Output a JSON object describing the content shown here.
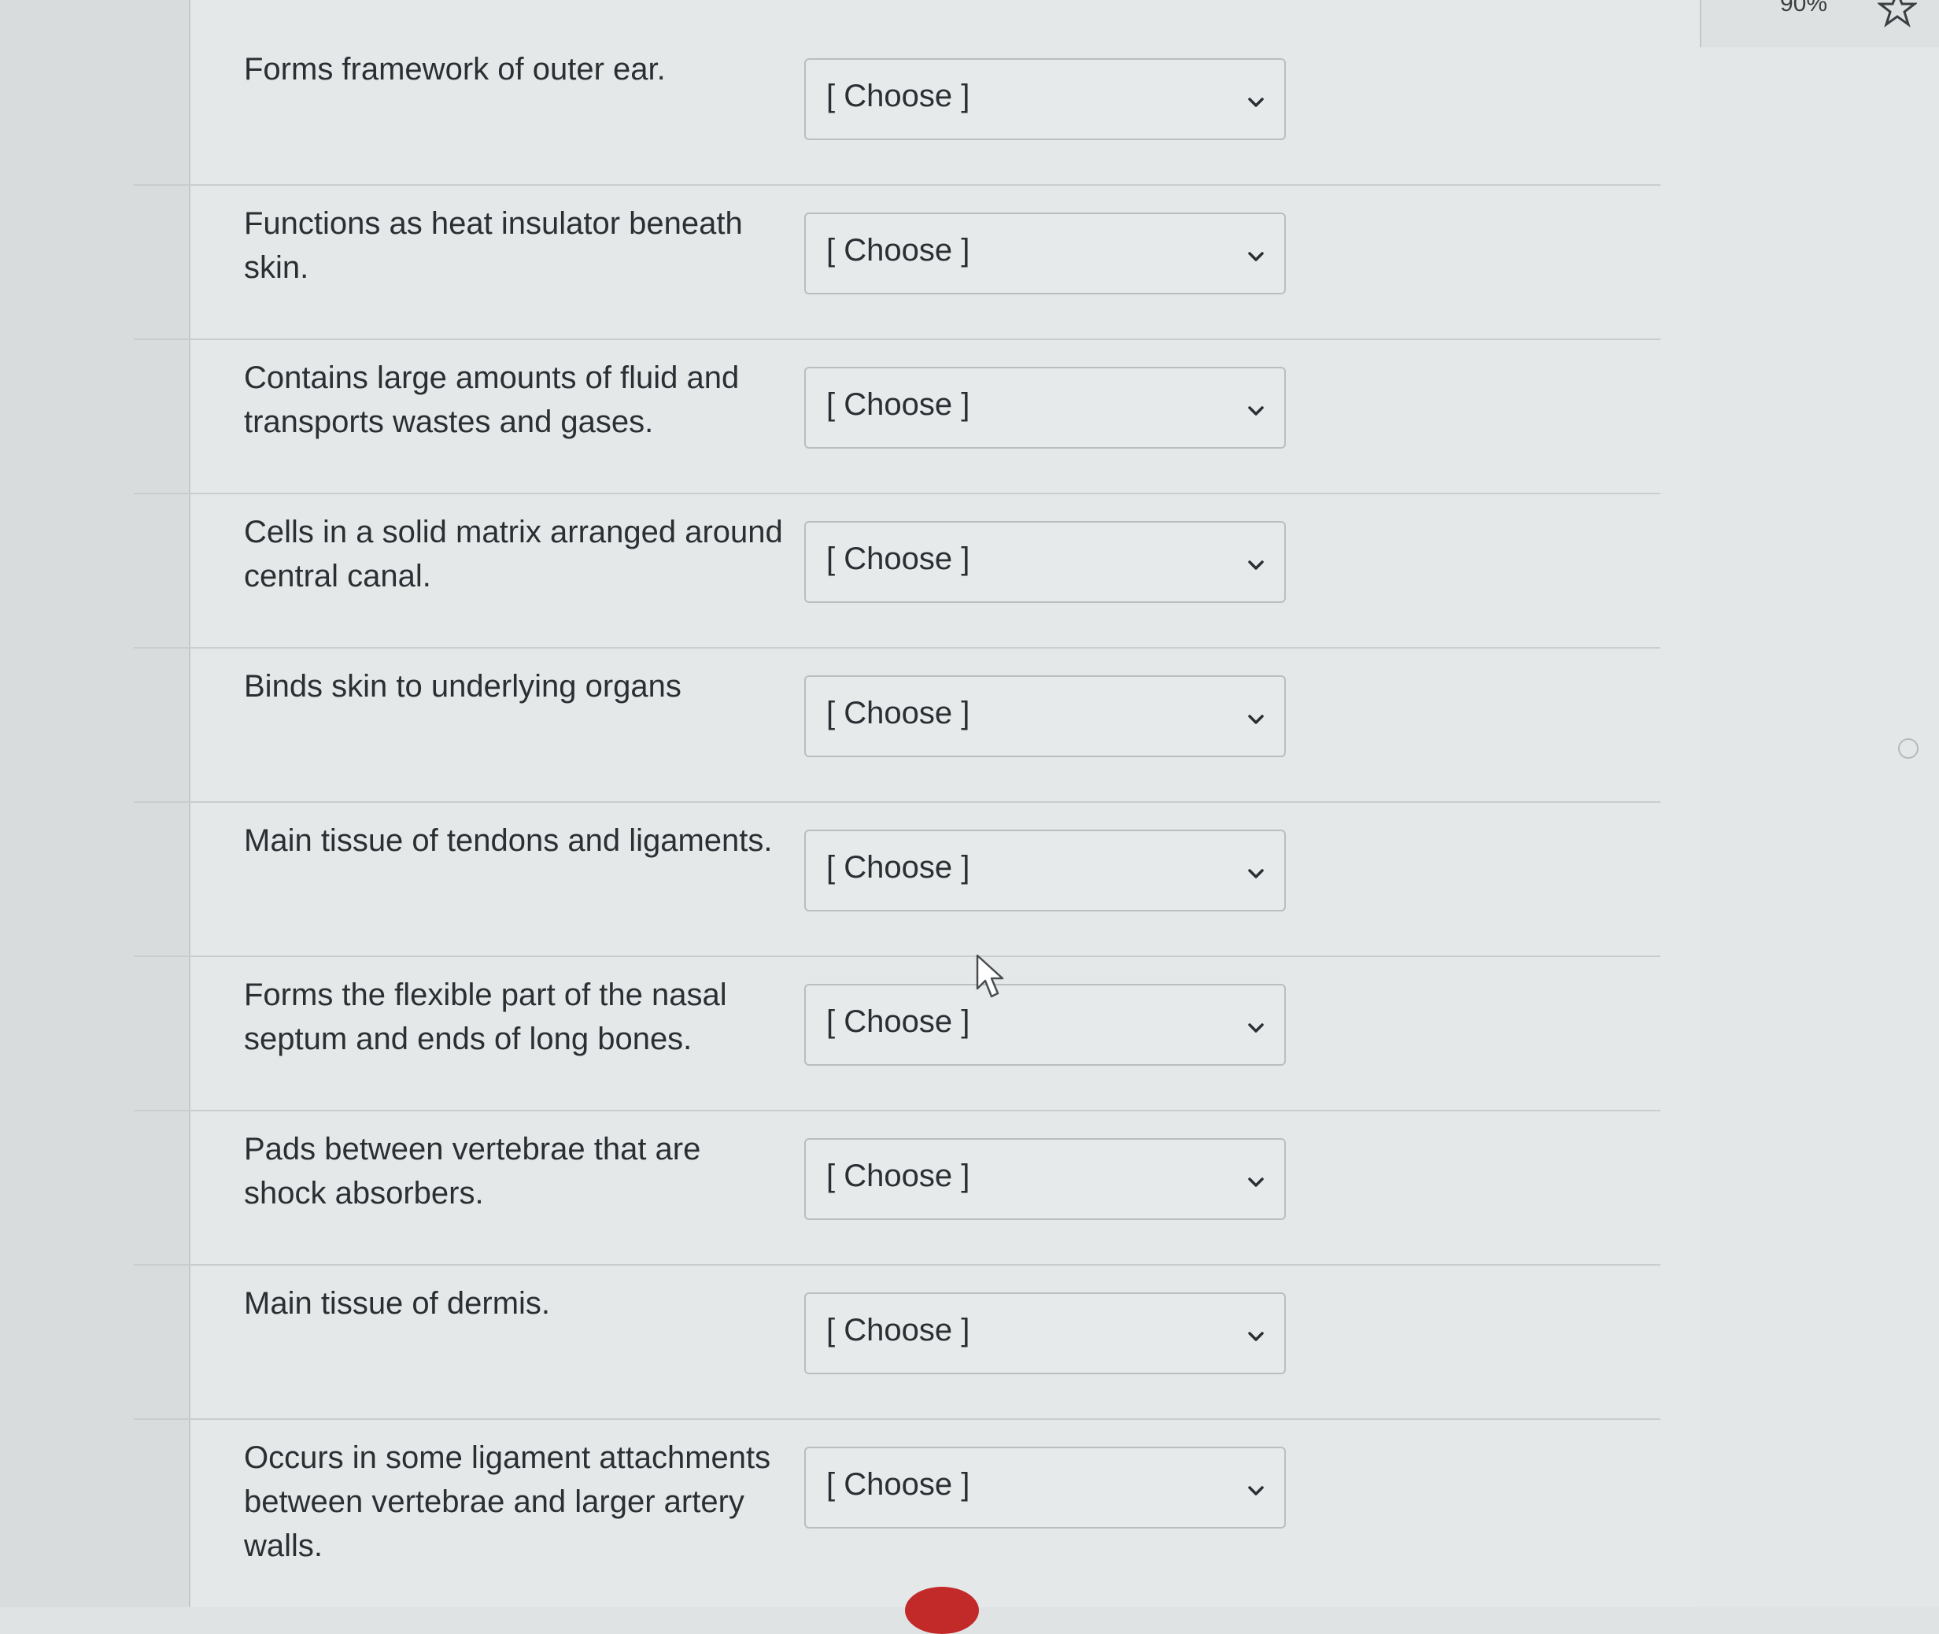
{
  "browser": {
    "zoom_level": "90%",
    "bookmark_icon": "star-icon"
  },
  "quiz": {
    "questions": [
      {
        "prompt": "Forms framework of outer ear.",
        "selected": "[ Choose ]"
      },
      {
        "prompt": "Functions as heat insulator beneath skin.",
        "selected": "[ Choose ]"
      },
      {
        "prompt": "Contains large amounts of fluid and transports wastes and gases.",
        "selected": "[ Choose ]"
      },
      {
        "prompt": "Cells in a solid matrix arranged around central canal.",
        "selected": "[ Choose ]"
      },
      {
        "prompt": "Binds skin to underlying organs",
        "selected": "[ Choose ]"
      },
      {
        "prompt": "Main tissue of tendons and ligaments.",
        "selected": "[ Choose ]"
      },
      {
        "prompt": "Forms the flexible part of the nasal septum and ends of long bones.",
        "selected": "[ Choose ]"
      },
      {
        "prompt": "Pads between vertebrae that are shock absorbers.",
        "selected": "[ Choose ]"
      },
      {
        "prompt": "Main tissue of dermis.",
        "selected": "[ Choose ]"
      },
      {
        "prompt": "Occurs in some ligament attachments between vertebrae and larger artery walls.",
        "selected": "[ Choose ]"
      }
    ]
  },
  "colors": {
    "panel_background": "#e4e8e9",
    "select_border": "#b9bec1",
    "text": "#2b2f33"
  }
}
